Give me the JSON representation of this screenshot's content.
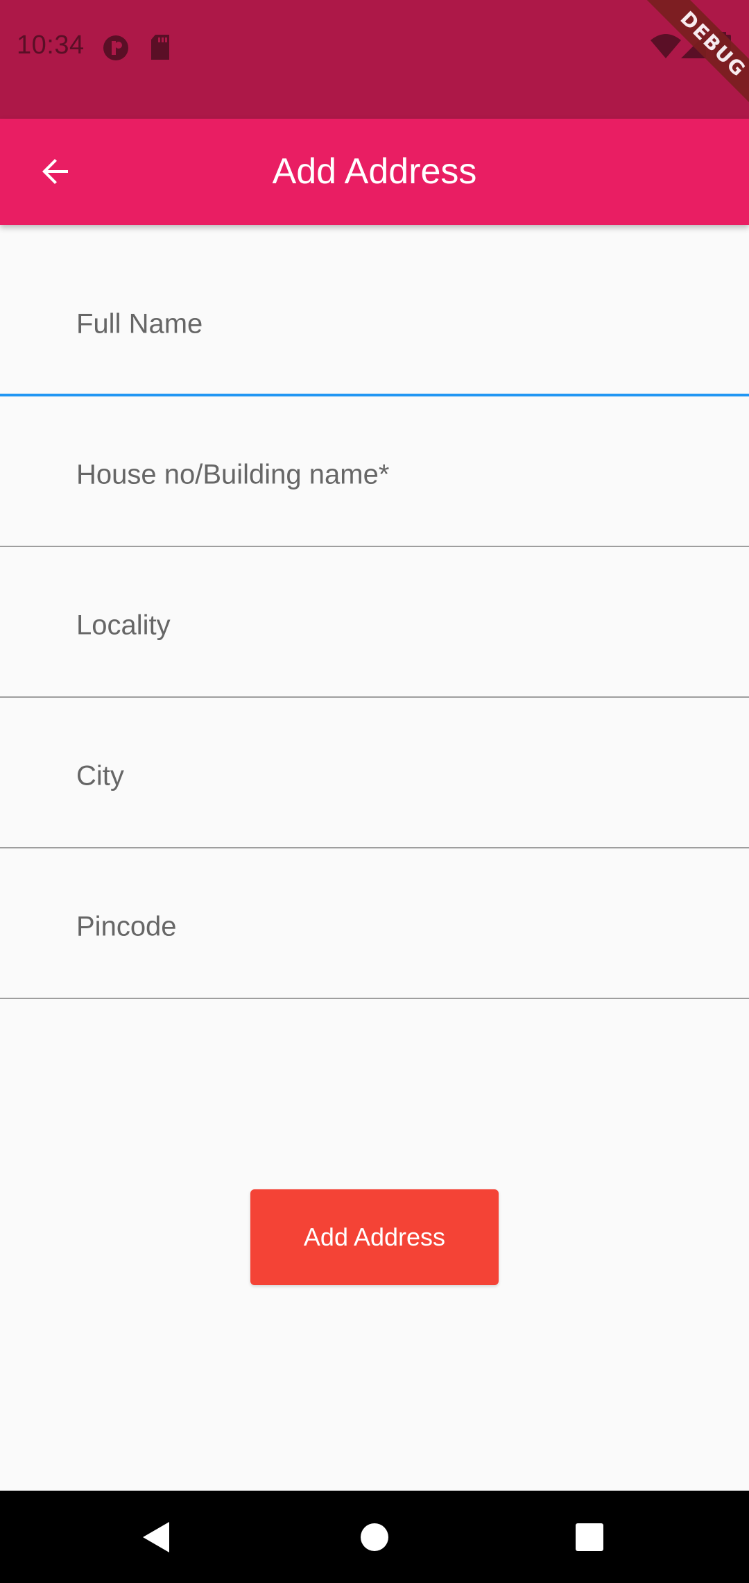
{
  "status_bar": {
    "time": "10:34",
    "icons": [
      "app-notification-icon",
      "sd-card-icon",
      "wifi-icon",
      "cell-signal-icon",
      "battery-icon"
    ],
    "debug_label": "DEBUG",
    "background_color": "#AD1848"
  },
  "app_bar": {
    "title": "Add Address",
    "back_icon": "arrow-back-icon",
    "background_color": "#E91E63"
  },
  "form": {
    "fields": [
      {
        "label": "Full Name",
        "value": "",
        "focused": true
      },
      {
        "label": "House no/Building name*",
        "value": "",
        "focused": false
      },
      {
        "label": "Locality",
        "value": "",
        "focused": false
      },
      {
        "label": "City",
        "value": "",
        "focused": false
      },
      {
        "label": "Pincode",
        "value": "",
        "focused": false
      }
    ],
    "focus_color": "#2196F3"
  },
  "actions": {
    "submit_label": "Add Address",
    "submit_color": "#F44336"
  },
  "nav_bar": {
    "buttons": [
      "back-triangle-icon",
      "home-circle-icon",
      "recents-square-icon"
    ]
  }
}
